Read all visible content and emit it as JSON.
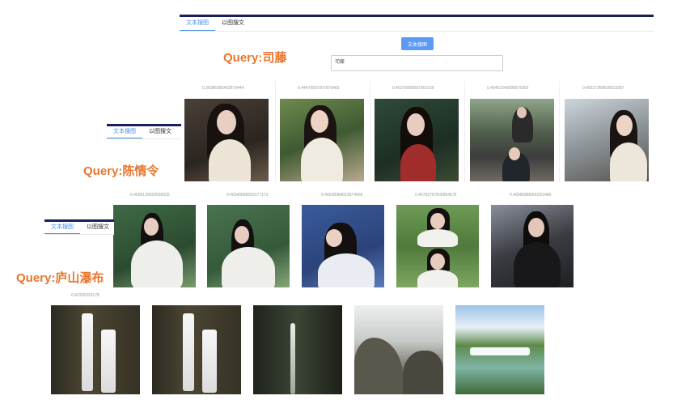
{
  "panels": [
    {
      "tabs": [
        "文本搜图",
        "以图搜文"
      ],
      "query_label": "Query:司藤",
      "search_button": "文本搜图",
      "input_value": "司藤",
      "scores": [
        "0.36386385402679444",
        "0.44479507207870483",
        "0.45276665687561035",
        "0.45452243089675903",
        "0.45517289638519287"
      ]
    },
    {
      "tabs": [
        "文本搜图",
        "以图搜文"
      ],
      "query_label": "Query:陈情令",
      "scores": [
        "0.4596120020556025",
        "0.46349588269177173",
        "0.46628084015674666",
        "0.46793767505864575",
        "0.46980888300323486"
      ]
    },
    {
      "tabs": [
        "文本搜图",
        "以图搜文"
      ],
      "query_label": "Query:庐山瀑布",
      "scores": [
        "0.42326325178"
      ]
    }
  ],
  "colors": {
    "accent": "#4a90e2",
    "query_label": "#e8762d",
    "tab_topline": "#1a1f5c",
    "button": "#5b9bf5"
  }
}
